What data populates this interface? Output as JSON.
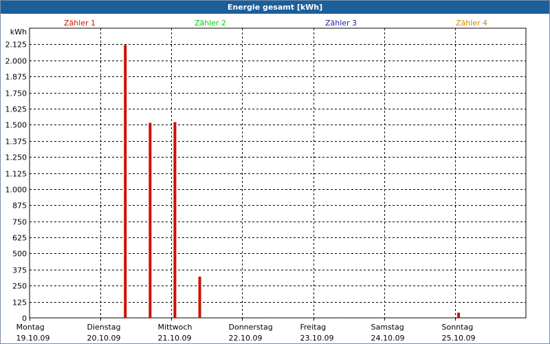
{
  "window": {
    "title": "Energie gesamt [kWh]"
  },
  "colors": {
    "title_bar": "#1c5e9a",
    "bar": "#cc1100",
    "grid": "#000000"
  },
  "chart_data": {
    "type": "bar",
    "title": "Energie gesamt [kWh]",
    "ylabel": "kWh",
    "ylim": [
      0,
      2250
    ],
    "yticks": [
      0,
      125,
      250,
      375,
      500,
      625,
      750,
      875,
      1000,
      1125,
      1250,
      1375,
      1500,
      1625,
      1750,
      1875,
      2000,
      2125
    ],
    "ytick_labels": [
      "0",
      "125",
      "250",
      "375",
      "500",
      "625",
      "750",
      "875",
      "1.000",
      "1.125",
      "1.250",
      "1.375",
      "1.500",
      "1.625",
      "1.750",
      "1.875",
      "2.000",
      "2.125"
    ],
    "x_days": [
      {
        "day": "Montag",
        "date": "19.10.09"
      },
      {
        "day": "Dienstag",
        "date": "20.10.09"
      },
      {
        "day": "Mittwoch",
        "date": "21.10.09"
      },
      {
        "day": "Donnerstag",
        "date": "22.10.09"
      },
      {
        "day": "Freitag",
        "date": "23.10.09"
      },
      {
        "day": "Samstag",
        "date": "24.10.09"
      },
      {
        "day": "Sonntag",
        "date": "25.10.09"
      }
    ],
    "legend": [
      {
        "name": "Zähler 1",
        "color": "#cc1100"
      },
      {
        "name": "Zähler 2",
        "color": "#00cc00"
      },
      {
        "name": "Zähler 3",
        "color": "#1a1aa8"
      },
      {
        "name": "Zähler 4",
        "color": "#cc8800"
      }
    ],
    "legend_position": "top",
    "grid": true,
    "series": [
      {
        "name": "Zähler 1",
        "color": "#cc1100",
        "points": [
          {
            "x": 1.35,
            "value": 2120
          },
          {
            "x": 1.7,
            "value": 1515
          },
          {
            "x": 2.05,
            "value": 1520
          },
          {
            "x": 2.4,
            "value": 320
          },
          {
            "x": 3.4,
            "value": 4
          },
          {
            "x": 4.4,
            "value": 4
          },
          {
            "x": 6.05,
            "value": 40
          }
        ]
      }
    ]
  }
}
